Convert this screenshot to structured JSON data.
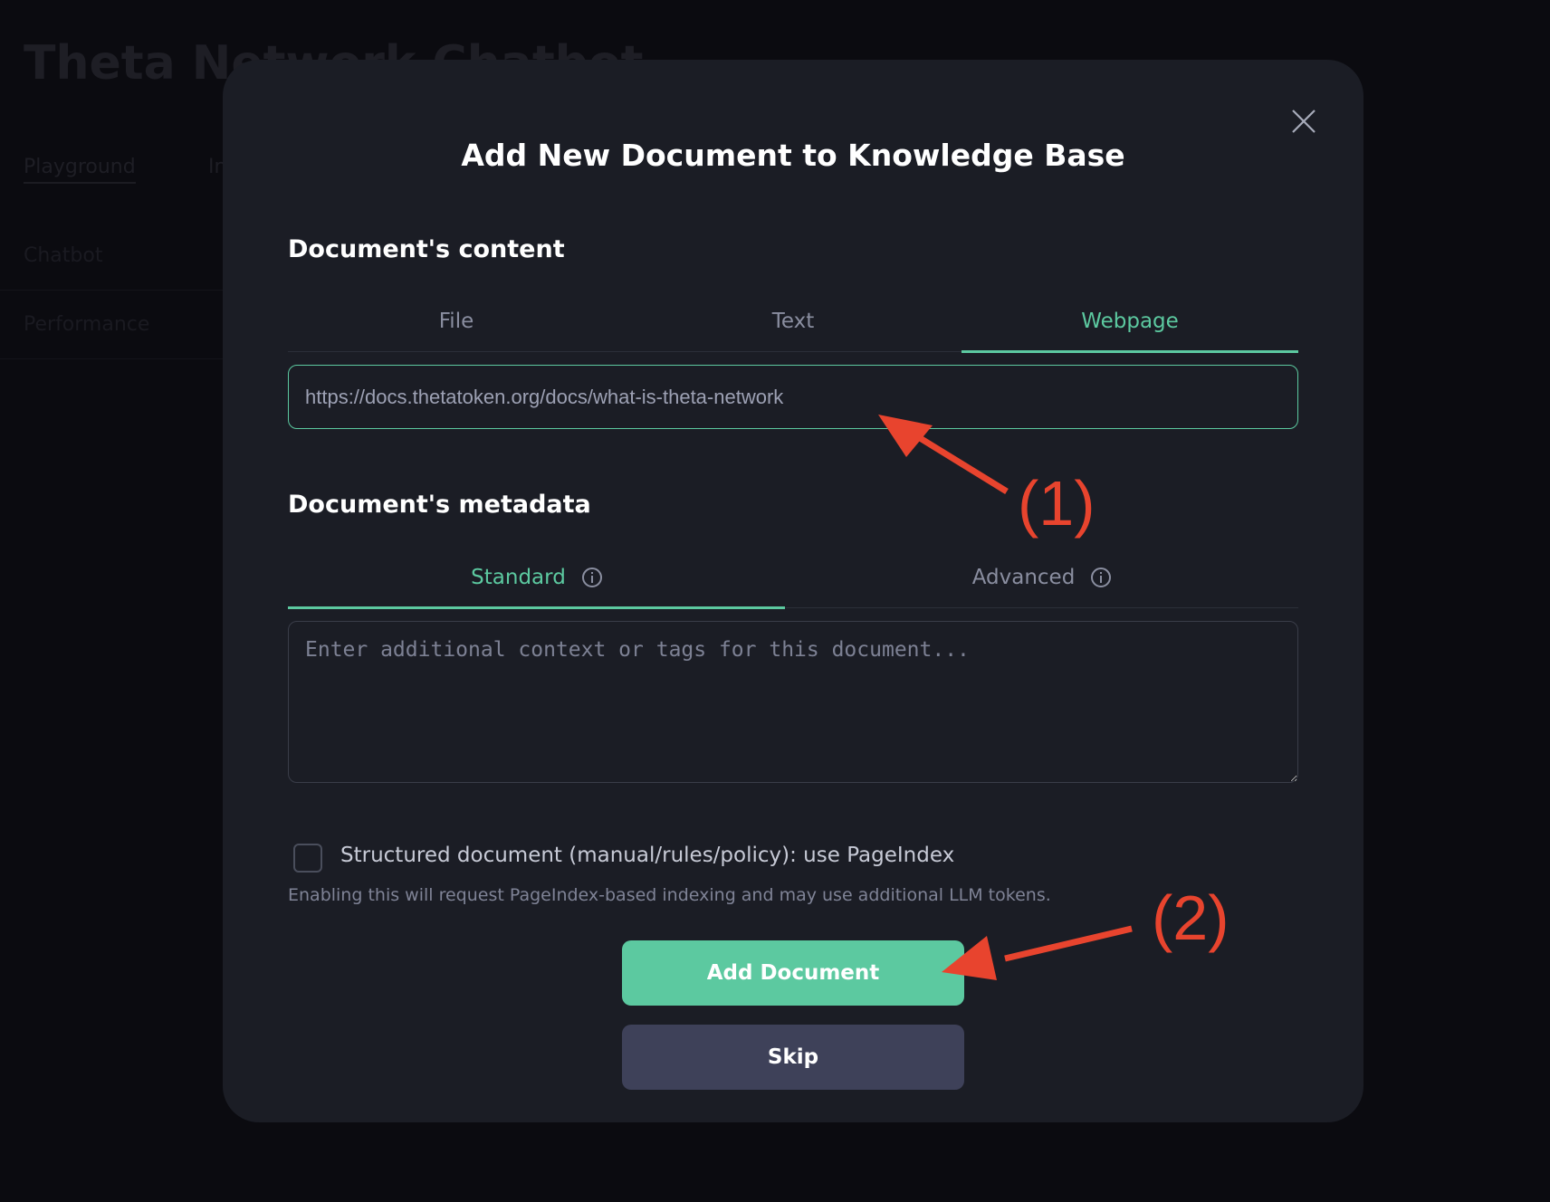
{
  "background": {
    "title": "Theta Network Chatbot",
    "tabs": [
      "Playground",
      "In"
    ],
    "sidebar_items": [
      "Chatbot",
      "Performance"
    ]
  },
  "modal": {
    "title": "Add New Document to Knowledge Base",
    "close_icon": "close-icon",
    "content_section": {
      "heading": "Document's content",
      "tabs": [
        {
          "label": "File",
          "active": false
        },
        {
          "label": "Text",
          "active": false
        },
        {
          "label": "Webpage",
          "active": true
        }
      ],
      "url_value": "https://docs.thetatoken.org/docs/what-is-theta-network"
    },
    "metadata_section": {
      "heading": "Document's metadata",
      "tabs": [
        {
          "label": "Standard",
          "active": true,
          "icon": "info-icon"
        },
        {
          "label": "Advanced",
          "active": false,
          "icon": "info-icon"
        }
      ],
      "placeholder": "Enter additional context or tags for this document..."
    },
    "structured_checkbox": {
      "label": "Structured document (manual/rules/policy): use PageIndex",
      "checked": false,
      "helper": "Enabling this will request PageIndex-based indexing and may use additional LLM tokens."
    },
    "buttons": {
      "add": "Add Document",
      "skip": "Skip"
    }
  },
  "annotations": {
    "one": "(1)",
    "two": "(2)"
  },
  "colors": {
    "accent": "#5cc9a0",
    "modal_bg": "#1b1d25",
    "page_bg": "#0b0b10",
    "secondary_button": "#3e4159",
    "annotation": "#e8442e"
  }
}
